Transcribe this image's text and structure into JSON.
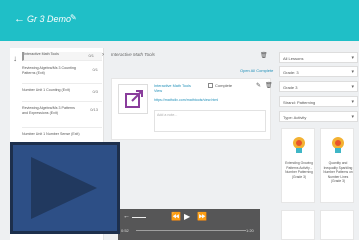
{
  "header": {
    "title": "Gr 3 Demo",
    "back_icon": "back-arrow-icon",
    "edit_icon": "pencil-icon",
    "bg_color": "#1fbfc7"
  },
  "sidebar": {
    "items": [
      {
        "label": "Interactive Math Tools",
        "num": "0/1"
      },
      {
        "label": "Reviewing Algebra/Ms 3 Counting Patterns (Exit)",
        "num": "0/1"
      },
      {
        "label": "Number Unit 1 Counting (Exit)",
        "num": "0/3"
      },
      {
        "label": "Reviewing Algebra/Ms 3 Patterns and Expressions (Exit)",
        "num": "0/13"
      },
      {
        "label": "Number Unit 1 Number Sense (Exit)",
        "num": ""
      }
    ]
  },
  "center": {
    "title": "Interactive Math Tools",
    "open_all": "Open All Complete",
    "card": {
      "title": "Interactive Math Tools",
      "subtitle": "View",
      "complete_label": "Complete",
      "url": "https://mathclix.com/mathtools/view.html",
      "note_placeholder": "Add a note..."
    }
  },
  "filters": [
    "All Lessons",
    "Grade: 3",
    "Grade 3",
    "Strand: Patterning",
    "Type: Activity"
  ],
  "resources": [
    {
      "label": "Extending Growing Patterns Activity - Number Patterning (Grade 3)"
    },
    {
      "label": "Quantity and Inequality Sparkling Number Patterns on Number Lines (Grade 3)"
    }
  ],
  "player": {
    "elapsed": "0:52",
    "duration": "1:20"
  },
  "video_overlay": {
    "icon": "play-icon",
    "color": "#2d4f86"
  }
}
